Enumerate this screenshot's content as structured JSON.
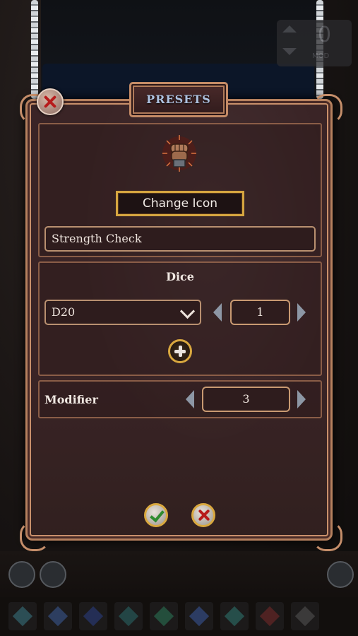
{
  "dialog": {
    "title": "PRESETS",
    "change_icon_label": "Change Icon",
    "preset_name_value": "Strength Check",
    "dice_section_label": "Dice",
    "dice_type_selected": "D20",
    "dice_count": "1",
    "modifier_label": "Modifier",
    "modifier_value": "3"
  },
  "background": {
    "counter_value": "0",
    "counter_label": "MOD"
  },
  "colors": {
    "dialog_bg": "#3a2426",
    "frame_copper": "#c58e6a",
    "gold_accent": "#d6a640",
    "title_text": "#aec2e0"
  },
  "icons": [
    "close-icon",
    "fist-icon",
    "chevron-down-icon",
    "arrow-left-icon",
    "arrow-right-icon",
    "plus-icon",
    "check-icon",
    "cancel-icon"
  ]
}
